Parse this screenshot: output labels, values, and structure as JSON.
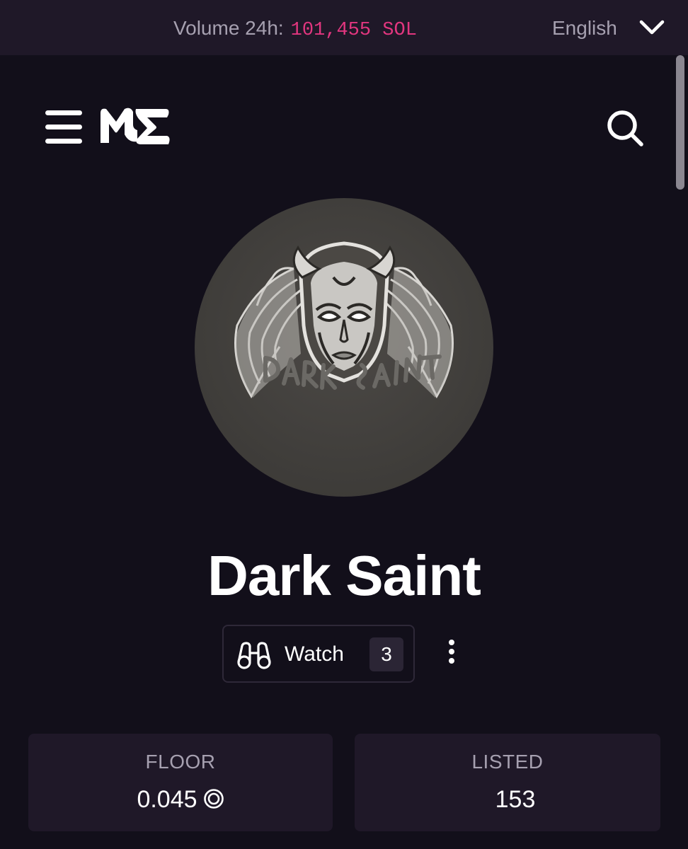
{
  "topbar": {
    "volume_label": "Volume 24h:",
    "volume_value": "101,455 SOL",
    "language": "English",
    "accent_color": "#e2367f"
  },
  "header": {
    "menu_icon": "hamburger-menu-icon",
    "logo_icon": "magic-eden-logo",
    "search_icon": "search-icon"
  },
  "collection": {
    "avatar_logo_text": "DARK SAINT",
    "title": "Dark Saint",
    "watch_label": "Watch",
    "watch_count": "3"
  },
  "stats": [
    {
      "label": "FLOOR",
      "value": "0.045",
      "currency_icon": "sol-icon"
    },
    {
      "label": "LISTED",
      "value": "153"
    }
  ]
}
